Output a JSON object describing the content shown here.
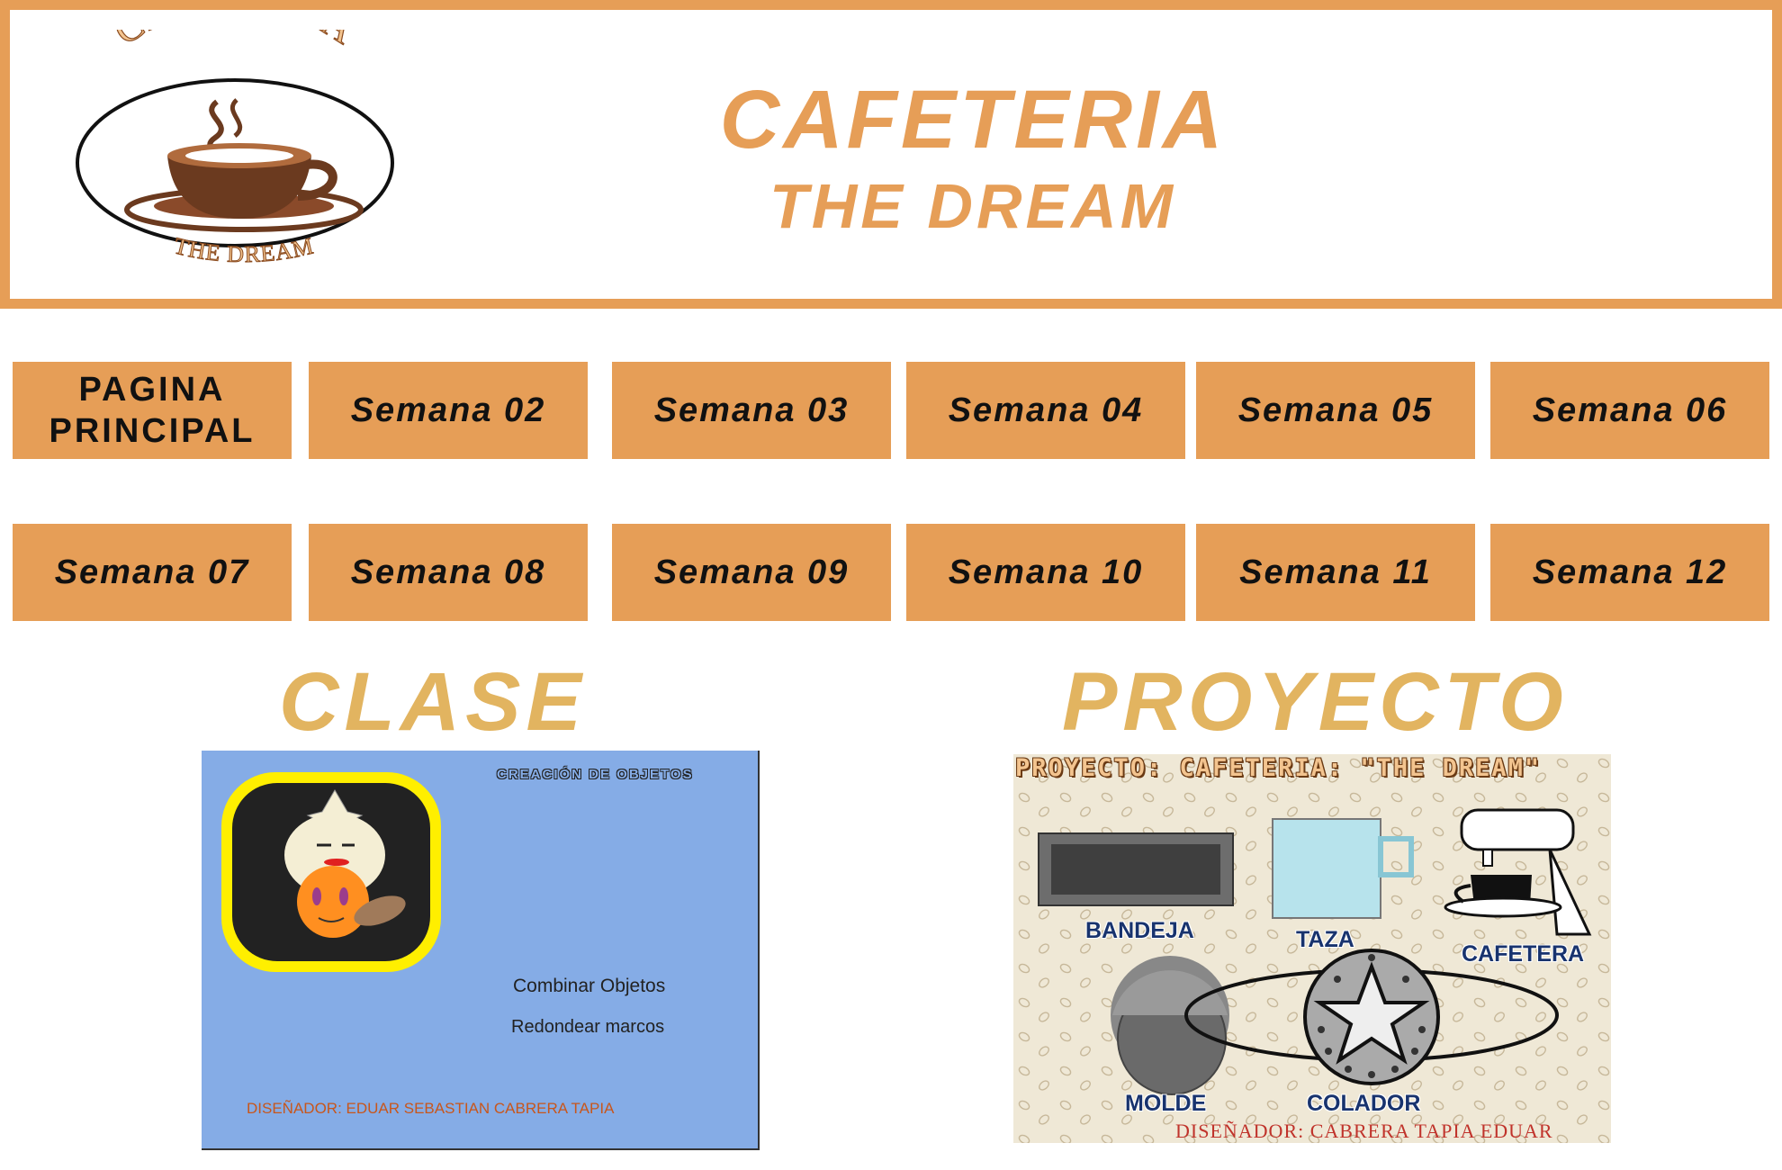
{
  "header": {
    "logo_text_top": "CAFETERIA",
    "logo_text_bottom": "THE DREAM",
    "title_line1": "CAFETERIA",
    "title_line2": "THE DREAM"
  },
  "nav": {
    "row1": [
      "PAGINA\nPRINCIPAL",
      "Semana 02",
      "Semana 03",
      "Semana 04",
      "Semana  05",
      "Semana 06"
    ],
    "row2": [
      "Semana 07",
      "Semana 08",
      "Semana 09",
      "Semana 10",
      "Semana 11",
      "Semana 12"
    ]
  },
  "sections": {
    "clase_title": "CLASE",
    "proyecto_title": "PROYECTO"
  },
  "clase_card": {
    "heading": "CREACIÓN DE OBJETOS",
    "line1": "Combinar Objetos",
    "line2": "Redondear marcos",
    "designer": "DISEÑADOR: EDUAR SEBASTIAN CABRERA TAPIA"
  },
  "proyecto_card": {
    "heading": "PROYECTO: CAFETERIA: \"THE DREAM\"",
    "labels": {
      "bandeja": "BANDEJA",
      "taza": "TAZA",
      "cafetera": "CAFETERA",
      "molde": "MOLDE",
      "colador": "COLADOR"
    },
    "designer": "DISEÑADOR: CABRERA TAPIA EDUAR"
  },
  "colors": {
    "accent_orange": "#e69e57",
    "section_gold": "#e2b460",
    "clase_bg": "#85ace6",
    "proyecto_bg": "#efe8d6"
  }
}
